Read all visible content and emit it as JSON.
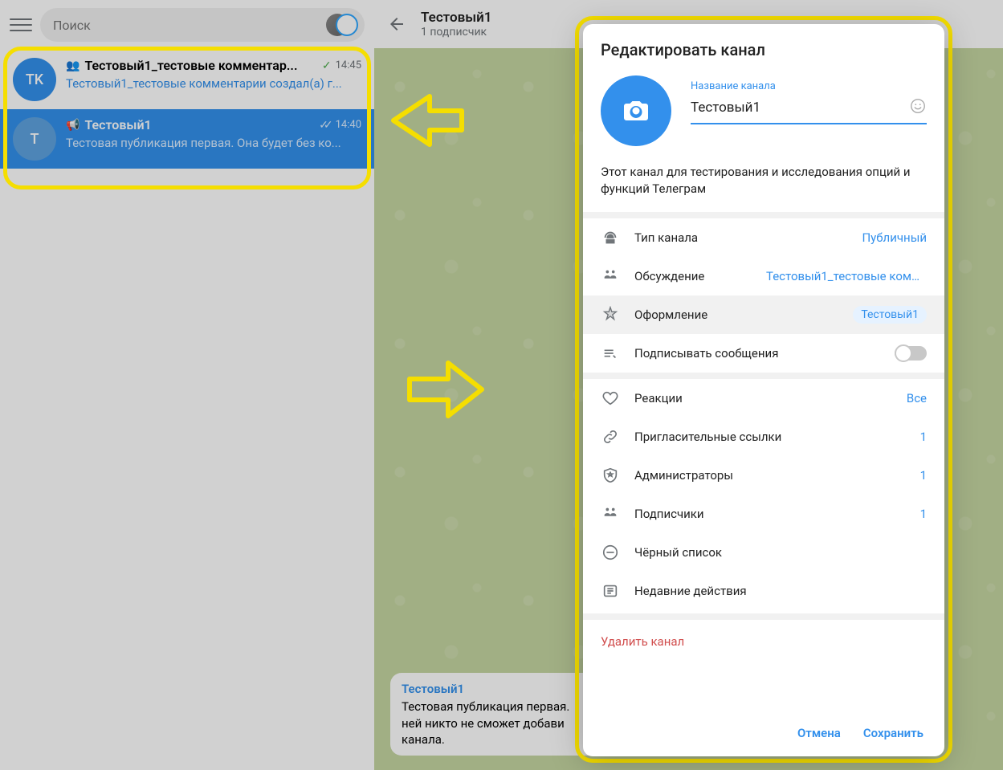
{
  "search": {
    "placeholder": "Поиск"
  },
  "chats": [
    {
      "avatar_text": "TK",
      "avatar_bg": "#3390ec",
      "title": "Тестовый1_тестовые комментар...",
      "time": "14:45",
      "preview": "Тестовый1_тестовые комментарии создал(а) г...",
      "tick": "single"
    },
    {
      "avatar_text": "T",
      "avatar_bg": "#3390ec",
      "title": "Тестовый1",
      "time": "14:40",
      "preview": "Тестовая публикация первая. Она будет без ко...",
      "tick": "double"
    }
  ],
  "header": {
    "title": "Тестовый1",
    "subtitle": "1 подписчик"
  },
  "message": {
    "sender": "Тестовый1",
    "body": "Тестовая публикация первая. ней никто не сможет добави канала."
  },
  "modal": {
    "title": "Редактировать канал",
    "name_label": "Название канала",
    "name_value": "Тестовый1",
    "description": "Этот канал для тестирования и исследования опций и функций Телеграм",
    "rows": {
      "type": {
        "label": "Тип канала",
        "value": "Публичный"
      },
      "discussion": {
        "label": "Обсуждение",
        "value": "Тестовый1_тестовые коммент..."
      },
      "appearance": {
        "label": "Оформление",
        "value": "Тестовый1"
      },
      "sign": {
        "label": "Подписывать сообщения"
      },
      "reactions": {
        "label": "Реакции",
        "value": "Все"
      },
      "invites": {
        "label": "Пригласительные ссылки",
        "value": "1"
      },
      "admins": {
        "label": "Администраторы",
        "value": "1"
      },
      "subscribers": {
        "label": "Подписчики",
        "value": "1"
      },
      "blacklist": {
        "label": "Чёрный список"
      },
      "recent": {
        "label": "Недавние действия"
      }
    },
    "delete": "Удалить канал",
    "cancel": "Отмена",
    "save": "Сохранить"
  }
}
